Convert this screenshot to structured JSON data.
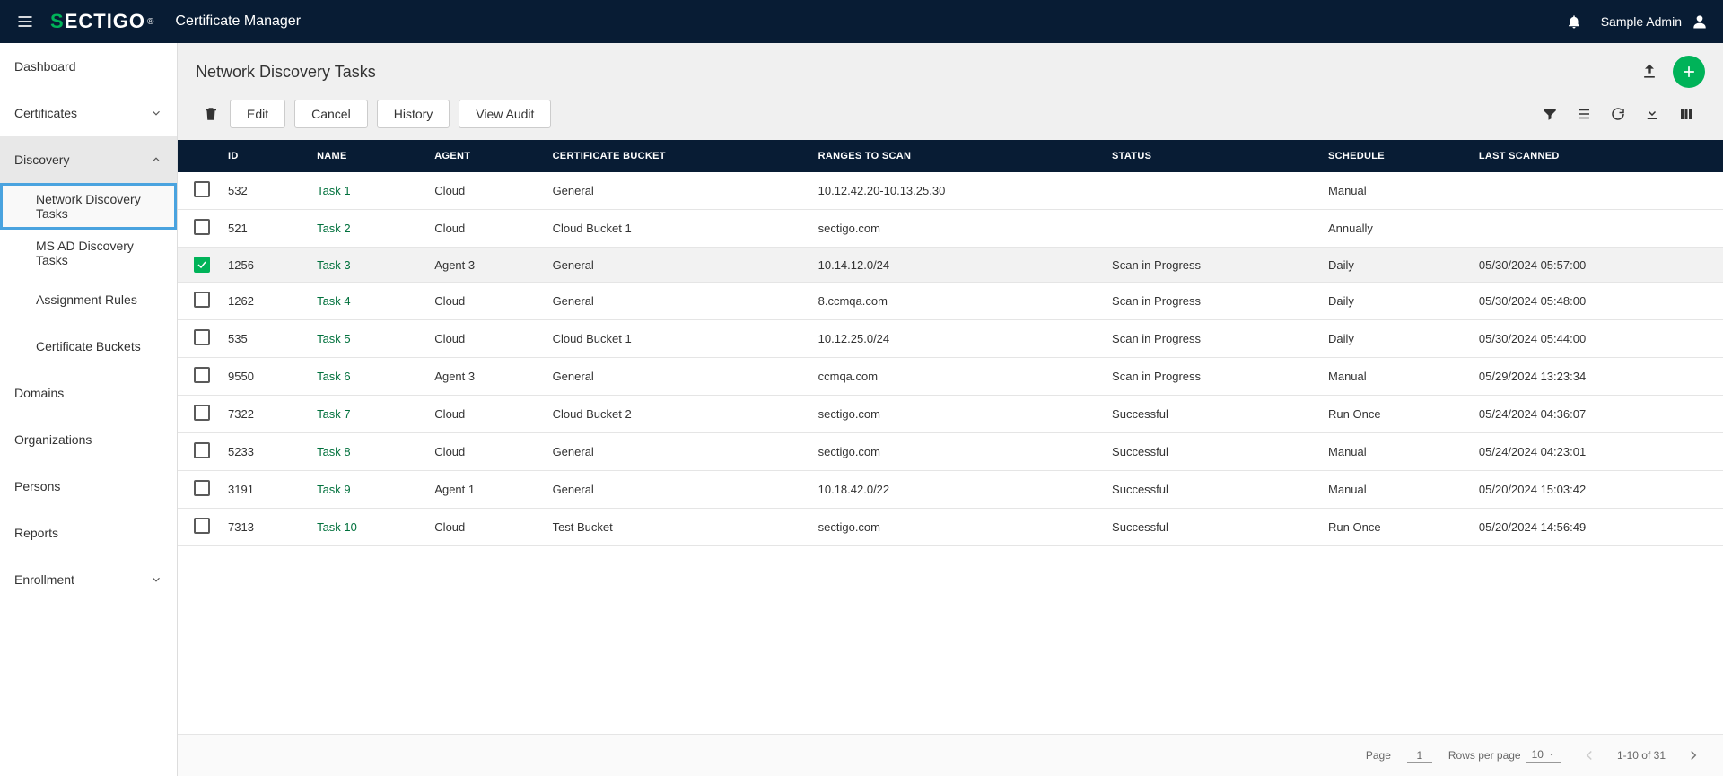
{
  "header": {
    "logo_pre": "S",
    "logo_rest": "ECTIGO",
    "app_title": "Certificate Manager",
    "user_name": "Sample Admin"
  },
  "sidebar": {
    "items": [
      {
        "label": "Dashboard",
        "has_children": false
      },
      {
        "label": "Certificates",
        "has_children": true,
        "expanded": false
      },
      {
        "label": "Discovery",
        "has_children": true,
        "expanded": true,
        "children": [
          {
            "label": "Network Discovery Tasks",
            "active": true
          },
          {
            "label": "MS AD Discovery Tasks",
            "active": false
          },
          {
            "label": "Assignment Rules",
            "active": false
          },
          {
            "label": "Certificate Buckets",
            "active": false
          }
        ]
      },
      {
        "label": "Domains",
        "has_children": false
      },
      {
        "label": "Organizations",
        "has_children": false
      },
      {
        "label": "Persons",
        "has_children": false
      },
      {
        "label": "Reports",
        "has_children": false
      },
      {
        "label": "Enrollment",
        "has_children": true,
        "expanded": false
      }
    ]
  },
  "page": {
    "title": "Network Discovery Tasks"
  },
  "toolbar": {
    "buttons": {
      "edit": "Edit",
      "cancel": "Cancel",
      "history": "History",
      "view_audit": "View Audit"
    }
  },
  "table": {
    "columns": [
      "ID",
      "NAME",
      "AGENT",
      "CERTIFICATE BUCKET",
      "RANGES TO SCAN",
      "STATUS",
      "SCHEDULE",
      "LAST SCANNED"
    ],
    "rows": [
      {
        "selected": false,
        "id": "532",
        "name": "Task 1",
        "agent": "Cloud",
        "bucket": "General",
        "ranges": "10.12.42.20-10.13.25.30",
        "status": "",
        "schedule": "Manual",
        "last": ""
      },
      {
        "selected": false,
        "id": "521",
        "name": "Task 2",
        "agent": "Cloud",
        "bucket": "Cloud Bucket 1",
        "ranges": "sectigo.com",
        "status": "",
        "schedule": "Annually",
        "last": ""
      },
      {
        "selected": true,
        "id": "1256",
        "name": "Task 3",
        "agent": "Agent 3",
        "bucket": "General",
        "ranges": "10.14.12.0/24",
        "status": "Scan in Progress",
        "schedule": "Daily",
        "last": "05/30/2024 05:57:00"
      },
      {
        "selected": false,
        "id": "1262",
        "name": "Task 4",
        "agent": "Cloud",
        "bucket": "General",
        "ranges": "8.ccmqa.com",
        "status": "Scan in Progress",
        "schedule": "Daily",
        "last": "05/30/2024 05:48:00"
      },
      {
        "selected": false,
        "id": "535",
        "name": "Task 5",
        "agent": "Cloud",
        "bucket": "Cloud Bucket 1",
        "ranges": "10.12.25.0/24",
        "status": "Scan in Progress",
        "schedule": "Daily",
        "last": "05/30/2024 05:44:00"
      },
      {
        "selected": false,
        "id": "9550",
        "name": "Task 6",
        "agent": "Agent 3",
        "bucket": "General",
        "ranges": "ccmqa.com",
        "status": "Scan in Progress",
        "schedule": "Manual",
        "last": "05/29/2024 13:23:34"
      },
      {
        "selected": false,
        "id": "7322",
        "name": "Task 7",
        "agent": "Cloud",
        "bucket": "Cloud Bucket 2",
        "ranges": "sectigo.com",
        "status": "Successful",
        "schedule": "Run Once",
        "last": "05/24/2024 04:36:07"
      },
      {
        "selected": false,
        "id": "5233",
        "name": "Task 8",
        "agent": "Cloud",
        "bucket": "General",
        "ranges": "sectigo.com",
        "status": "Successful",
        "schedule": "Manual",
        "last": "05/24/2024 04:23:01"
      },
      {
        "selected": false,
        "id": "3191",
        "name": "Task 9",
        "agent": "Agent 1",
        "bucket": "General",
        "ranges": "10.18.42.0/22",
        "status": "Successful",
        "schedule": "Manual",
        "last": "05/20/2024 15:03:42"
      },
      {
        "selected": false,
        "id": "7313",
        "name": "Task 10",
        "agent": "Cloud",
        "bucket": "Test Bucket",
        "ranges": "sectigo.com",
        "status": "Successful",
        "schedule": "Run Once",
        "last": "05/20/2024 14:56:49"
      }
    ]
  },
  "pager": {
    "page_label": "Page",
    "page_value": "1",
    "rpp_label": "Rows per page",
    "rpp_value": "10",
    "range_text": "1-10 of 31"
  }
}
